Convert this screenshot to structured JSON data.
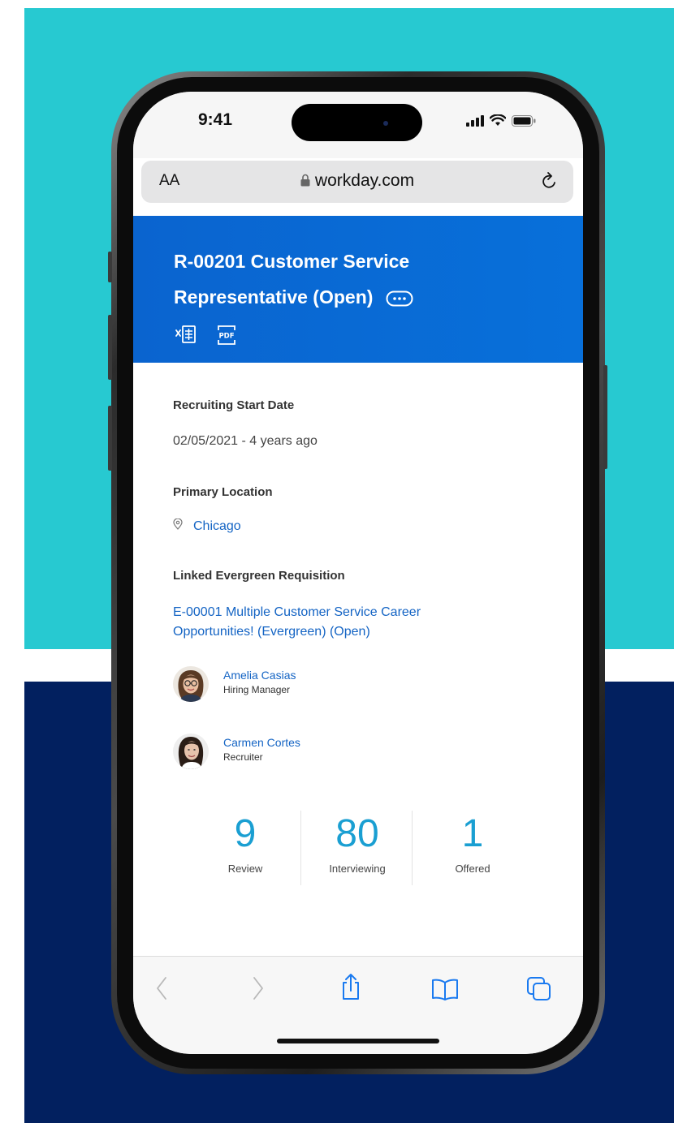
{
  "status_bar": {
    "time": "9:41"
  },
  "browser": {
    "text_size_label": "AA",
    "url": "workday.com"
  },
  "requisition": {
    "title": "R-00201 Customer Service Representative (Open)"
  },
  "fields": {
    "start_date_label": "Recruiting Start Date",
    "start_date_value": "02/05/2021 - 4 years ago",
    "location_label": "Primary Location",
    "location_value": "Chicago",
    "linked_label": "Linked Evergreen Requisition",
    "linked_value": "E-00001 Multiple Customer Service Career Opportunities! (Evergreen) (Open)"
  },
  "people": [
    {
      "name": "Amelia Casias",
      "role": "Hiring Manager"
    },
    {
      "name": "Carmen Cortes",
      "role": "Recruiter"
    }
  ],
  "stats": [
    {
      "value": "9",
      "label": "Review"
    },
    {
      "value": "80",
      "label": "Interviewing"
    },
    {
      "value": "1",
      "label": "Offered"
    }
  ],
  "colors": {
    "header_blue": "#0a64cf",
    "link_blue": "#1464c4",
    "stat_blue": "#1a9fd2",
    "background_teal": "#27c9d1",
    "background_navy": "#02205f"
  }
}
